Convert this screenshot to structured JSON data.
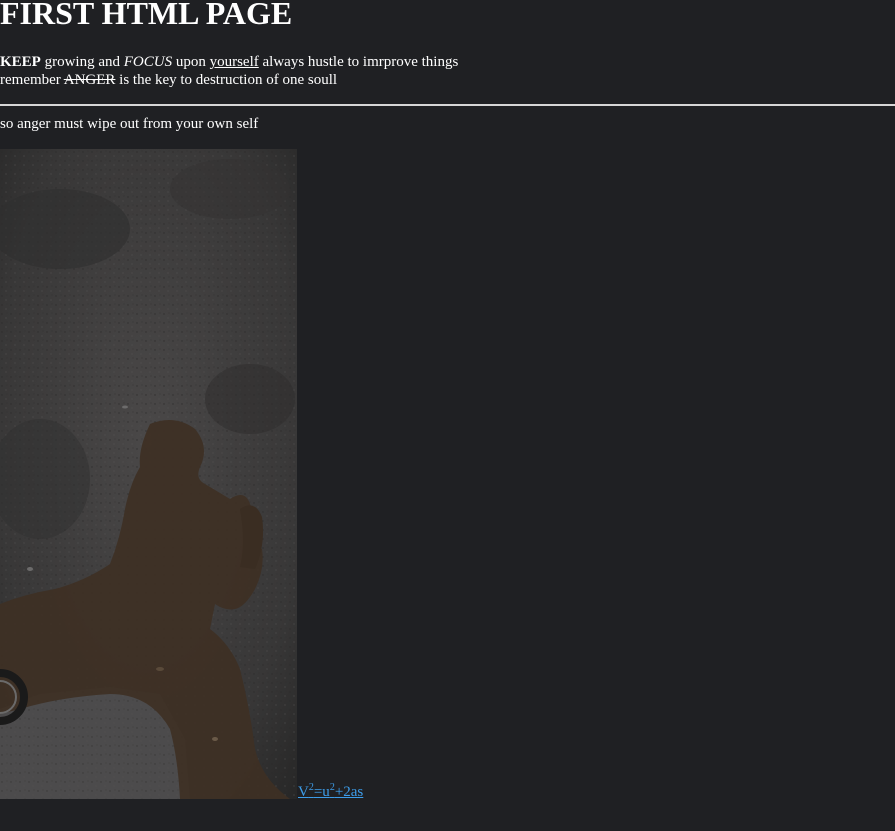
{
  "heading": "FIRST HTML PAGE",
  "intro": {
    "line1": {
      "bold": "KEEP",
      "text1": " growing and ",
      "italic": "FOCUS",
      "text2": " upon ",
      "underline": "yourself",
      "text3": " always hustle to imrprove things"
    },
    "line2": {
      "text1": "remember ",
      "strike": "ANGER",
      "text2": " is the key to destruction of one soull"
    }
  },
  "second_paragraph": "so anger must wipe out from your own self",
  "image": {
    "icon": "shadow-photo"
  },
  "formula_link": {
    "v": "V",
    "exp1": "2",
    "eq": "=u",
    "exp2": "2",
    "rest": "+2as"
  },
  "colors": {
    "background": "#1f2023",
    "text": "#ffffff",
    "link": "#3d9dea"
  }
}
